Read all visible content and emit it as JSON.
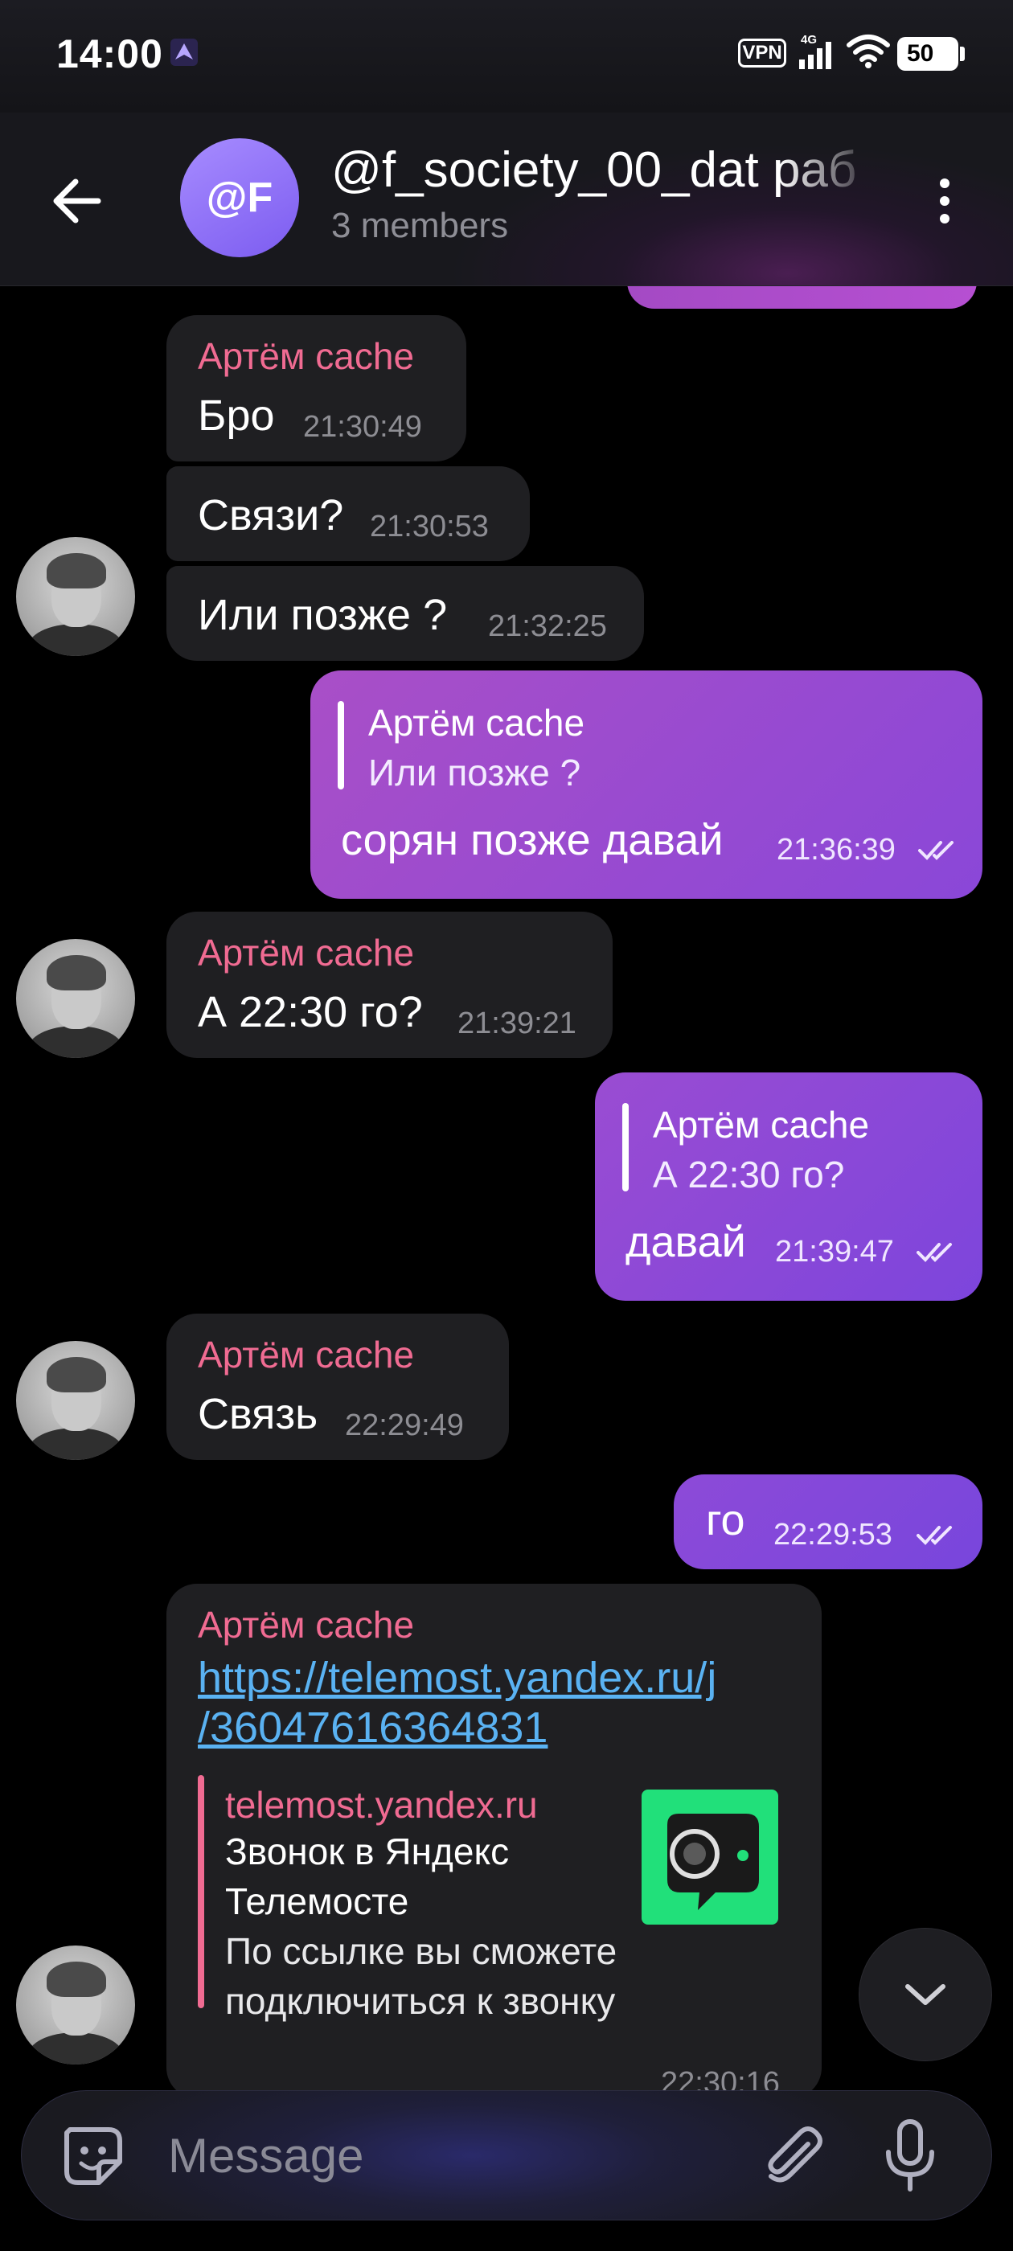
{
  "status_bar": {
    "time": "14:00",
    "vpn": "VPN",
    "network": "4G",
    "battery": "50"
  },
  "header": {
    "avatar_initials": "@F",
    "title": "@f_society_00_dat раб",
    "subtitle": "3 members"
  },
  "messages": {
    "m1": {
      "sender": "Артём cache",
      "text": "Бро",
      "time": "21:30:49"
    },
    "m2": {
      "text": "Связи?",
      "time": "21:30:53"
    },
    "m3": {
      "text": "Или позже ?",
      "time": "21:32:25"
    },
    "m4": {
      "reply_name": "Артём cache",
      "reply_text": "Или позже ?",
      "text": "сорян позже давай",
      "time": "21:36:39"
    },
    "m5": {
      "sender": "Артём cache",
      "text": "А 22:30 го?",
      "time": "21:39:21"
    },
    "m6": {
      "reply_name": "Артём cache",
      "reply_text": "А 22:30 го?",
      "text": "давай",
      "time": "21:39:47"
    },
    "m7": {
      "sender": "Артём cache",
      "text": "Связь",
      "time": "22:29:49"
    },
    "m8": {
      "text": "го",
      "time": "22:29:53"
    },
    "m9": {
      "sender": "Артём cache",
      "link_line1": "https://telemost.yandex.ru/j",
      "link_line2": "/36047616364831",
      "preview_site": "telemost.yandex.ru",
      "preview_title_line1": "Звонок в Яндекс",
      "preview_title_line2": "Телемосте",
      "preview_desc_line1": "По ссылке вы сможете",
      "preview_desc_line2": "подключиться к звонку",
      "time": "22:30:16"
    }
  },
  "composer": {
    "placeholder": "Message"
  },
  "colors": {
    "incoming_bubble": "#1f1f22",
    "outgoing_start": "#a44ac4",
    "outgoing_end": "#7a47d9",
    "sender_name": "#f06b92",
    "link": "#5ab2f2",
    "preview_thumb": "#21e07a"
  },
  "icons": [
    "back-arrow-icon",
    "more-vertical-icon",
    "double-check-icon",
    "chevron-down-icon",
    "sticker-icon",
    "paperclip-icon",
    "microphone-icon"
  ]
}
